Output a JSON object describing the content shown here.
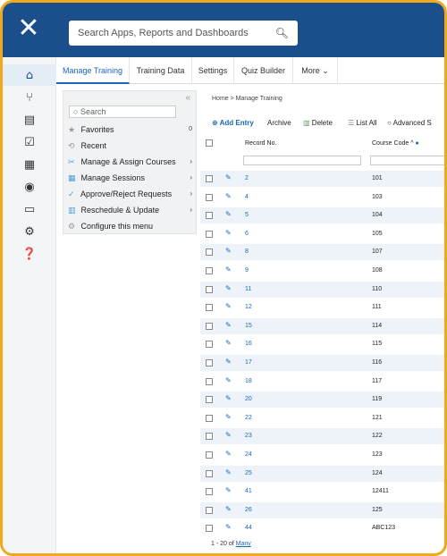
{
  "search": {
    "placeholder": "Search Apps, Reports and Dashboards"
  },
  "rail": {
    "icons": [
      "home-icon",
      "workflow-icon",
      "reports-icon",
      "checklist-icon",
      "presentation-icon",
      "eye-icon",
      "calendar-icon",
      "gear-icon",
      "help-icon"
    ]
  },
  "tabs": [
    "Manage Training",
    "Training Data",
    "Settings",
    "Quiz Builder",
    "More"
  ],
  "menu": {
    "search_placeholder": "Search",
    "items": [
      {
        "label": "Favorites",
        "count": "0"
      },
      {
        "label": "Recent"
      },
      {
        "label": "Manage & Assign Courses"
      },
      {
        "label": "Manage Sessions"
      },
      {
        "label": "Approve/Reject Requests"
      },
      {
        "label": "Reschedule & Update"
      },
      {
        "label": "Configure this menu"
      }
    ]
  },
  "breadcrumb": "Home > Manage Training",
  "toolbar": {
    "add": "Add Entry",
    "archive": "Archive",
    "delete": "Delete",
    "list_all": "List All",
    "advanced": "Advanced S"
  },
  "table": {
    "columns": [
      "Record No.",
      "Course Code"
    ],
    "rows": [
      {
        "record": "2",
        "code": "101"
      },
      {
        "record": "4",
        "code": "103"
      },
      {
        "record": "5",
        "code": "104"
      },
      {
        "record": "6",
        "code": "105"
      },
      {
        "record": "8",
        "code": "107"
      },
      {
        "record": "9",
        "code": "108"
      },
      {
        "record": "11",
        "code": "110"
      },
      {
        "record": "12",
        "code": "111"
      },
      {
        "record": "15",
        "code": "114"
      },
      {
        "record": "16",
        "code": "115"
      },
      {
        "record": "17",
        "code": "116"
      },
      {
        "record": "18",
        "code": "117"
      },
      {
        "record": "20",
        "code": "119"
      },
      {
        "record": "22",
        "code": "121"
      },
      {
        "record": "23",
        "code": "122"
      },
      {
        "record": "24",
        "code": "123"
      },
      {
        "record": "25",
        "code": "124"
      },
      {
        "record": "41",
        "code": "12411"
      },
      {
        "record": "26",
        "code": "125"
      },
      {
        "record": "44",
        "code": "ABC123"
      }
    ]
  },
  "pagination": {
    "range": "1 - 20 of",
    "total": "Many"
  },
  "colors": {
    "topbar": "#1a4f8c",
    "frame": "#f0a81c",
    "link": "#1a66b8"
  }
}
